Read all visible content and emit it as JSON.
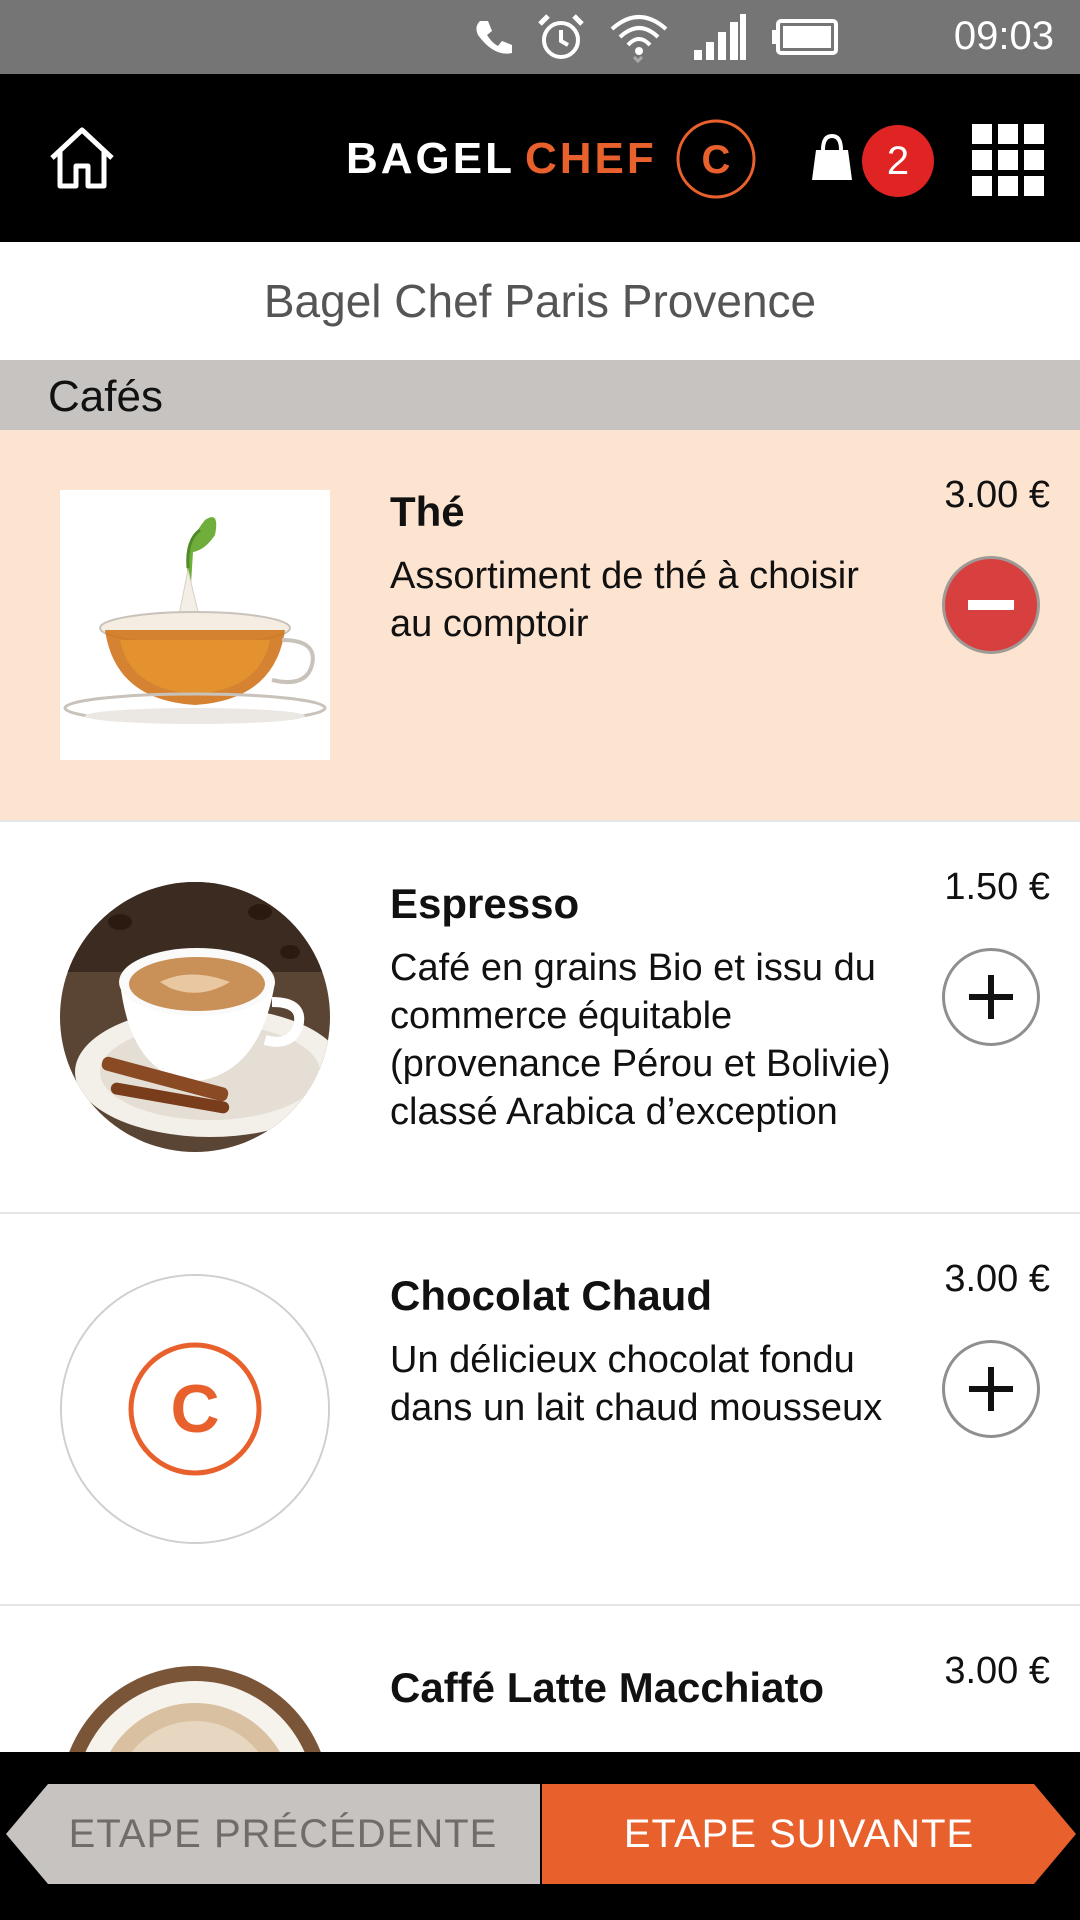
{
  "status_bar": {
    "time": "09:03",
    "icons": [
      "phone-icon",
      "alarm-icon",
      "wifi-icon",
      "signal-icon",
      "battery-icon"
    ]
  },
  "header": {
    "home_icon": "home-icon",
    "logo": {
      "part1": "BAGEL",
      "part2": "CHEF",
      "mark": "C"
    },
    "cart_icon": "shopping-bag-icon",
    "cart_count": "2",
    "menu_icon": "grid-menu-icon"
  },
  "store": {
    "name": "Bagel Chef Paris Provence"
  },
  "category": {
    "label": "Cafés"
  },
  "products": [
    {
      "name": "Thé",
      "description": "Assortiment de thé à choisir au comptoir",
      "price": "3.00 €",
      "selected": true,
      "action": "remove",
      "image": "tea-cup-image"
    },
    {
      "name": "Espresso",
      "description": "Café en grains Bio et issu du commerce équitable (provenance Pérou et Bolivie) classé Arabica d’exception",
      "price": "1.50 €",
      "selected": false,
      "action": "add",
      "image": "espresso-cup-image"
    },
    {
      "name": "Chocolat Chaud",
      "description": "Un délicieux chocolat fondu dans un lait chaud mousseux",
      "price": "3.00 €",
      "selected": false,
      "action": "add",
      "image": "bagelchef-logo-placeholder"
    },
    {
      "name": "Caffé Latte Macchiato",
      "description": "",
      "price": "3.00 €",
      "selected": false,
      "action": "add",
      "image": "latte-cup-image"
    }
  ],
  "navigation": {
    "prev_label": "ETAPE PRÉCÉDENTE",
    "next_label": "ETAPE SUIVANTE"
  },
  "colors": {
    "brand_orange": "#e8612d",
    "selected_row": "#fde4d1",
    "badge_red": "#e02323",
    "remove_red": "#d8403f",
    "category_gray": "#c6c3c1"
  }
}
